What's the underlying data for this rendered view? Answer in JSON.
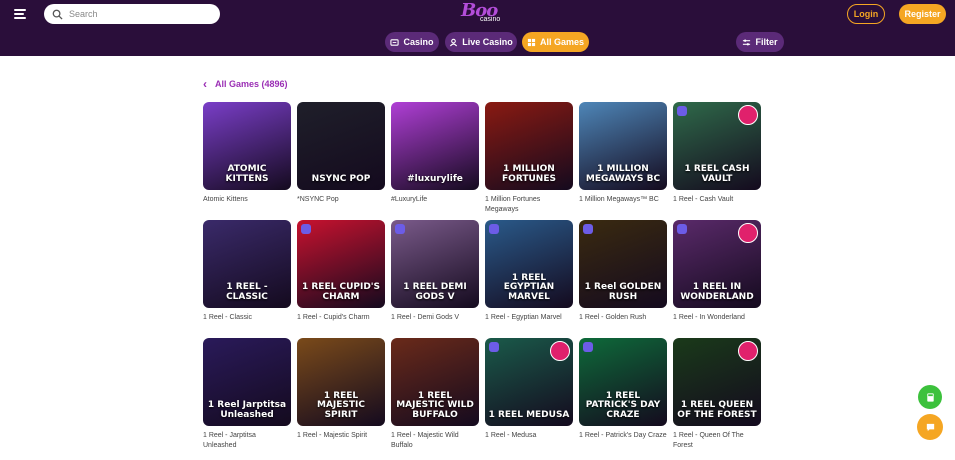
{
  "header": {
    "search_placeholder": "Search",
    "logo_text": "Boo",
    "logo_sub": "casino",
    "login_label": "Login",
    "register_label": "Register"
  },
  "nav": {
    "casino_label": "Casino",
    "live_label": "Live Casino",
    "all_label": "All Games",
    "filter_label": "Filter"
  },
  "section": {
    "back_icon": "chevron-left-icon",
    "title": "All Games (4896)"
  },
  "games": [
    {
      "name": "Atomic Kittens",
      "art": "ATOMIC KITTENS",
      "bg": "#7a3ec8"
    },
    {
      "name": "*NSYNC Pop",
      "art": "NSYNC POP",
      "bg": "#1f1f2a"
    },
    {
      "name": "#LuxuryLife",
      "art": "#luxurylife",
      "bg": "#b03fd6"
    },
    {
      "name": "1 Million Fortunes Megaways",
      "art": "1 MILLION FORTUNES",
      "bg": "#8a1a12"
    },
    {
      "name": "1 Million Megaways™ BC",
      "art": "1 MILLION MEGAWAYS BC",
      "bg": "#4e86b8"
    },
    {
      "name": "1 Reel - Cash Vault",
      "art": "1 REEL CASH VAULT",
      "bg": "#2f6a4a"
    },
    {
      "name": "1 Reel - Classic",
      "art": "1 REEL - CLASSIC",
      "bg": "#3a2a6a"
    },
    {
      "name": "1 Reel - Cupid's Charm",
      "art": "1 REEL CUPID'S CHARM",
      "bg": "#c8122f"
    },
    {
      "name": "1 Reel - Demi Gods V",
      "art": "1 REEL DEMI GODS V",
      "bg": "#7a5a8a"
    },
    {
      "name": "1 Reel - Egyptian Marvel",
      "art": "1 REEL EGYPTIAN MARVEL",
      "bg": "#2a5a8a"
    },
    {
      "name": "1 Reel - Golden Rush",
      "art": "1 Reel GOLDEN RUSH",
      "bg": "#3a2a10"
    },
    {
      "name": "1 Reel - In Wonderland",
      "art": "1 REEL IN WONDERLAND",
      "bg": "#5a2a6a"
    },
    {
      "name": "1 Reel - Jarptitsa Unleashed",
      "art": "1 Reel Jarptitsa Unleashed",
      "bg": "#2a1a5a"
    },
    {
      "name": "1 Reel - Majestic Spirit",
      "art": "1 REEL MAJESTIC SPIRIT",
      "bg": "#7a4a1a"
    },
    {
      "name": "1 Reel - Majestic Wild Buffalo",
      "art": "1 REEL MAJESTIC WILD BUFFALO",
      "bg": "#6a2a1a"
    },
    {
      "name": "1 Reel - Medusa",
      "art": "1 REEL MEDUSA",
      "bg": "#1a5a4a"
    },
    {
      "name": "1 Reel - Patrick's Day Craze",
      "art": "1 REEL PATRICK'S DAY CRAZE",
      "bg": "#0e6a3a"
    },
    {
      "name": "1 Reel - Queen Of The Forest",
      "art": "1 REEL QUEEN OF THE FOREST",
      "bg": "#1a3a1a"
    }
  ]
}
